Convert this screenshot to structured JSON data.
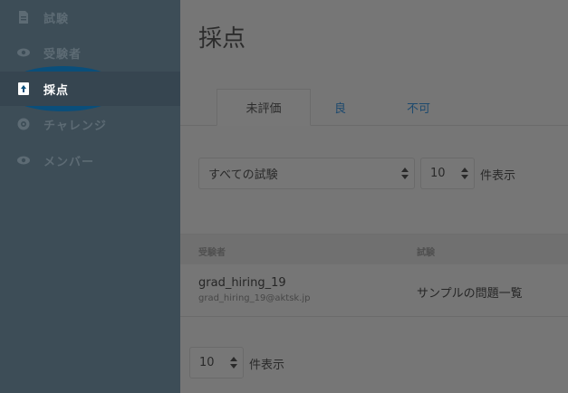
{
  "sidebar": {
    "items": [
      {
        "label": "試験",
        "icon": "document-icon"
      },
      {
        "label": "受験者",
        "icon": "eye-icon"
      },
      {
        "label": "採点",
        "icon": "upload-doc-icon",
        "active": true
      },
      {
        "label": "チャレンジ",
        "icon": "target-icon"
      },
      {
        "label": "メンバー",
        "icon": "eye-icon"
      }
    ]
  },
  "main": {
    "title": "採点",
    "tabs": [
      {
        "label": "未評価",
        "active": true
      },
      {
        "label": "良"
      },
      {
        "label": "不可"
      }
    ],
    "filters": {
      "exam_select": "すべての試験",
      "per_page_value": "10",
      "per_page_label": "件表示"
    },
    "table": {
      "columns": [
        "受験者",
        "試験"
      ],
      "rows": [
        {
          "user": "grad_hiring_19",
          "email": "grad_hiring_19@aktsk.jp",
          "exam": "サンプルの問題一覧"
        }
      ]
    },
    "footer": {
      "per_page_value": "10",
      "per_page_label": "件表示"
    }
  },
  "colors": {
    "sidebar": "#3d4d57",
    "highlight": "#0a4e7a",
    "overlay": "#767676",
    "link": "#1e4a6e"
  }
}
